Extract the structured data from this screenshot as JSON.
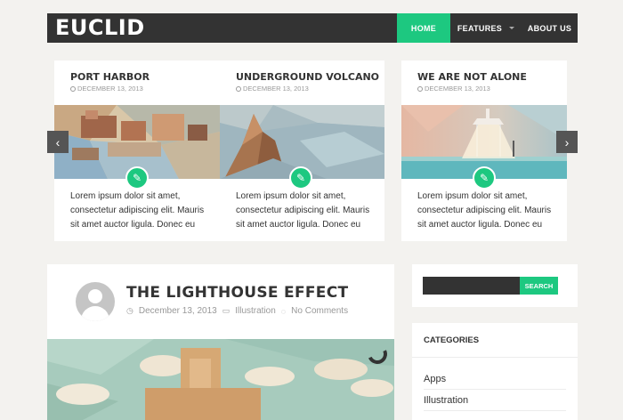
{
  "header": {
    "logo": "EUCLID",
    "nav": [
      {
        "label": "HOME"
      },
      {
        "label": "FEATURES"
      },
      {
        "label": "ABOUT US"
      }
    ]
  },
  "slider": {
    "cards": [
      {
        "title": "PORT HARBOR",
        "date": "DECEMBER 13, 2013",
        "excerpt": [
          "Lorem ipsum dolor sit amet,",
          "consectetur adipiscing elit. Mauris",
          "sit amet auctor ligula. Donec eu"
        ]
      },
      {
        "title": "UNDERGROUND VOLCANO",
        "date": "DECEMBER 13, 2013",
        "excerpt": [
          "Lorem ipsum dolor sit amet,",
          "consectetur adipiscing elit. Mauris",
          "sit amet auctor ligula. Donec eu"
        ]
      },
      {
        "title": "WE ARE NOT ALONE",
        "date": "DECEMBER 13, 2013",
        "excerpt": [
          "Lorem ipsum dolor sit amet,",
          "consectetur adipiscing elit. Mauris",
          "sit amet auctor ligula. Donec eu"
        ]
      }
    ],
    "prev_icon": "chevron-left-icon",
    "next_icon": "chevron-right-icon"
  },
  "post": {
    "title": "THE LIGHTHOUSE EFFECT",
    "date": "December 13, 2013",
    "category": "Illustration",
    "comments": "No Comments"
  },
  "sidebar": {
    "search": {
      "placeholder": "",
      "button": "SEARCH"
    },
    "categories": {
      "title": "CATEGORIES",
      "items": [
        "Apps",
        "Illustration"
      ]
    }
  },
  "colors": {
    "accent": "#1dc880",
    "dark": "#333333",
    "background": "#f3f2ef"
  }
}
